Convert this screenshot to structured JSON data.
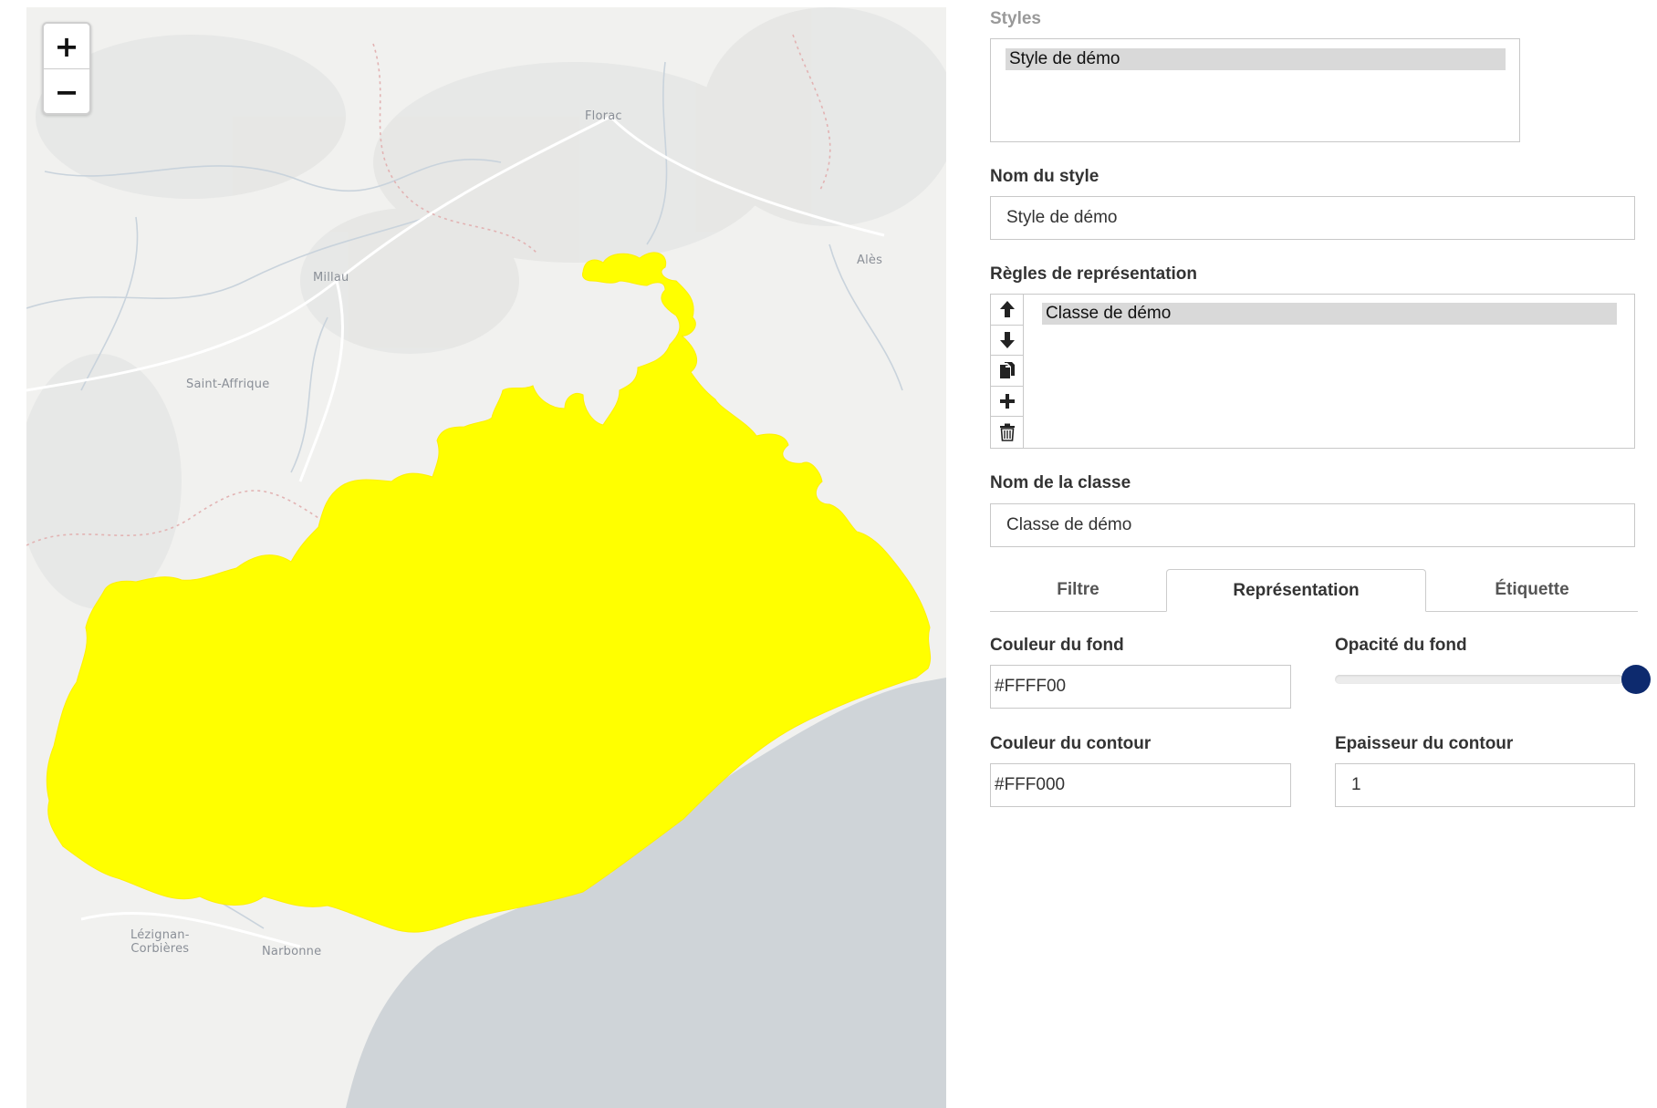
{
  "map": {
    "zoom_in": "+",
    "zoom_out": "−",
    "places": {
      "florac": "Florac",
      "ales": "Alès",
      "millau": "Millau",
      "saint_affrique": "Saint-Affrique",
      "lezignan": "Lézignan-\nCorbières",
      "narbonne": "Narbonne"
    },
    "colors": {
      "land": "#f2f2f0",
      "sea": "#cfd4d8",
      "region_fill": "#FFFF00",
      "roads": "#ffffff",
      "rivers": "#c9d3dc"
    }
  },
  "panel": {
    "styles_label": "Styles",
    "styles_list": [
      "Style de démo"
    ],
    "style_name_label": "Nom du style",
    "style_name_value": "Style de démo",
    "rules_label": "Règles de représentation",
    "rules_list": [
      "Classe de démo"
    ],
    "rule_tools": [
      "arrow-up-icon",
      "arrow-down-icon",
      "copy-icon",
      "plus-icon",
      "trash-icon"
    ],
    "class_name_label": "Nom de la classe",
    "class_name_value": "Classe de démo",
    "tabs": [
      "Filtre",
      "Représentation",
      "Étiquette"
    ],
    "active_tab": "Représentation",
    "fill_color_label": "Couleur du fond",
    "fill_color_value": "#FFFF00",
    "fill_opacity_label": "Opacité du fond",
    "fill_opacity_value": 1.0,
    "stroke_color_label": "Couleur du contour",
    "stroke_color_value": "#FFF000",
    "stroke_width_label": "Epaisseur du contour",
    "stroke_width_value": "1",
    "slider_color": "#0d2a6e"
  }
}
